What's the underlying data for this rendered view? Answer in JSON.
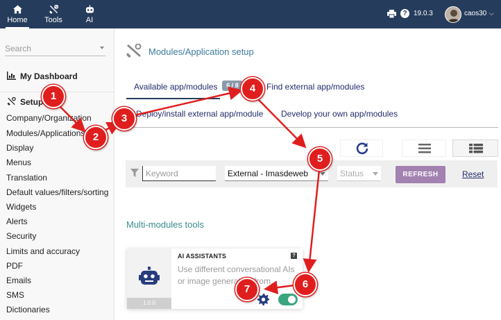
{
  "topbar": {
    "nav": [
      {
        "label": "Home",
        "icon": "home-icon",
        "active": true
      },
      {
        "label": "Tools",
        "icon": "tools-icon",
        "active": false
      },
      {
        "label": "AI",
        "icon": "robot-icon",
        "active": false
      }
    ],
    "version": "19.0.3",
    "help_glyph": "?",
    "username": "caos30",
    "colors": {
      "topbar": "#263c5c",
      "accent_purple": "#a381b0",
      "toggle_green": "#3aa57e",
      "annotation_red": "#e01e1e"
    }
  },
  "sidebar": {
    "search_placeholder": "Search",
    "dashboard_label": "My Dashboard",
    "setup_label": "Setup",
    "items": [
      "Company/Organization",
      "Modules/Applications",
      "Display",
      "Menus",
      "Translation",
      "Default values/filters/sorting",
      "Widgets",
      "Alerts",
      "Security",
      "Limits and accuracy",
      "PDF",
      "Emails",
      "SMS",
      "Dictionaries"
    ]
  },
  "main": {
    "title": "Modules/Application setup",
    "tabs": {
      "available": "Available app/modules",
      "badge": "6 / 8",
      "find_external": "Find external app/modules",
      "deploy": "Deploy/install external app/module",
      "develop": "Develop your own app/modules"
    },
    "filters": {
      "keyword_placeholder": "Keyword",
      "source_selected": "External - Imasdeweb",
      "status_placeholder": "Status",
      "refresh_label": "REFRESH",
      "reset_label": "Reset"
    },
    "section_title": "Multi-modules tools",
    "card": {
      "title": "AI ASSISTANTS",
      "description": "Use different conversational AIs or image generation from...",
      "version": "1.0.0",
      "help_glyph": "?",
      "enabled": true
    }
  },
  "annotations": {
    "steps": [
      "1",
      "2",
      "3",
      "4",
      "5",
      "6",
      "7"
    ]
  }
}
